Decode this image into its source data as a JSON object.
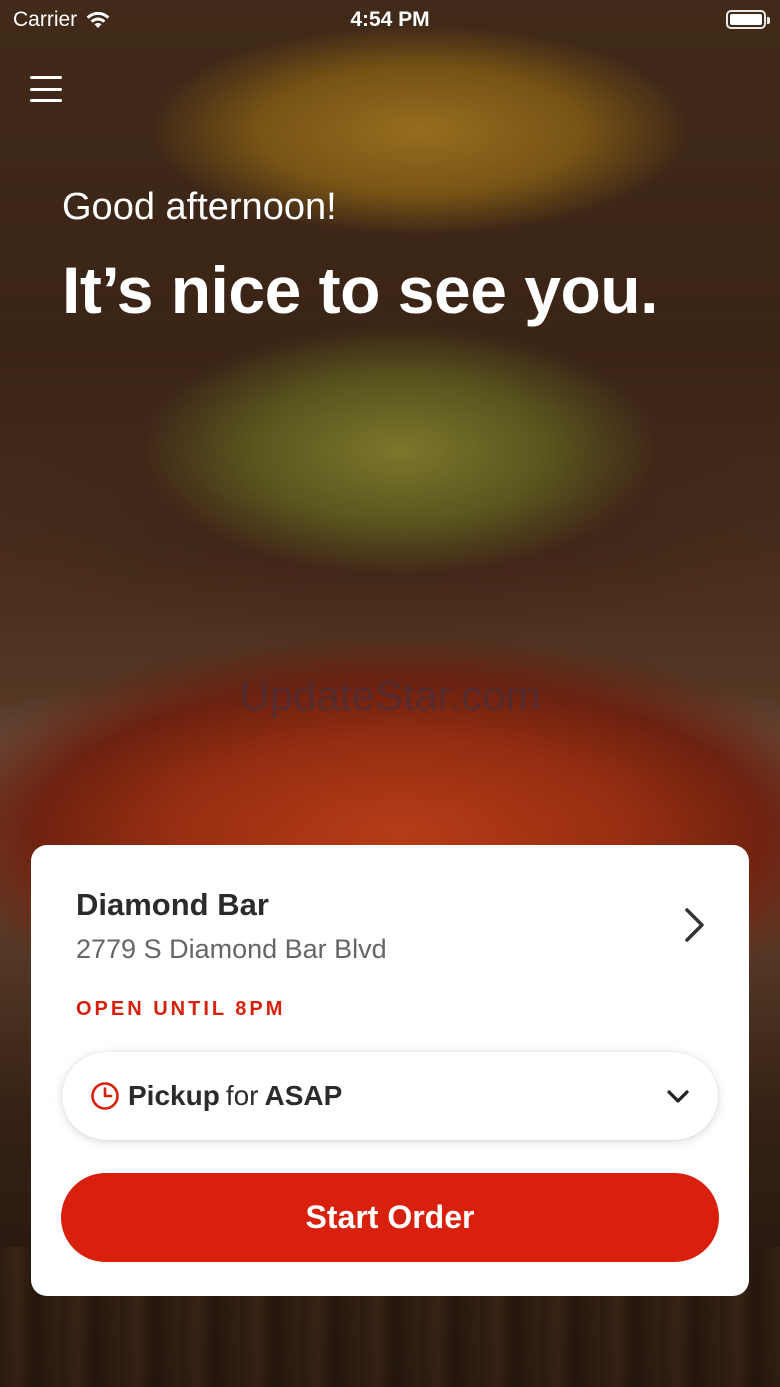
{
  "status_bar": {
    "carrier": "Carrier",
    "time": "4:54 PM",
    "wifi_icon": "wifi-icon",
    "battery_icon": "battery-icon"
  },
  "header": {
    "menu_icon": "hamburger-menu-icon",
    "greeting": "Good afternoon!",
    "headline": "It’s nice to see you."
  },
  "watermark": "UpdateStar.com",
  "location_card": {
    "store_name": "Diamond Bar",
    "store_address": "2779 S Diamond Bar Blvd",
    "store_hours": "OPEN UNTIL 8PM",
    "chevron_icon": "chevron-right-icon",
    "pickup": {
      "clock_icon": "clock-icon",
      "mode": "Pickup",
      "connector": "for",
      "time": "ASAP",
      "dropdown_icon": "chevron-down-icon"
    },
    "start_order_label": "Start Order"
  },
  "colors": {
    "accent": "#d8200c",
    "card_background": "#ffffff",
    "text_dark": "#2b2b2b",
    "text_muted": "#666666"
  }
}
